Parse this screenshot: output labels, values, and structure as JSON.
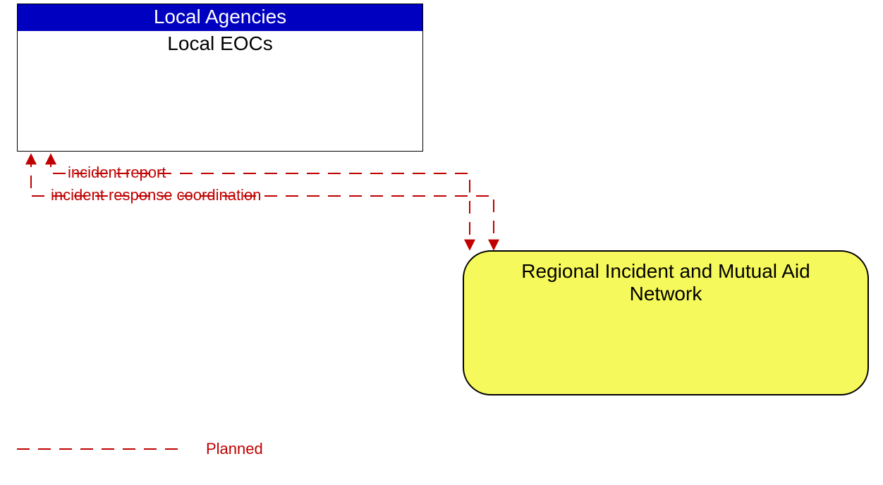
{
  "nodes": {
    "localAgencies": {
      "header": "Local Agencies",
      "body": "Local EOCs"
    },
    "regionNode": {
      "line1": "Regional Incident and Mutual Aid",
      "line2": "Network"
    }
  },
  "flows": {
    "incidentReport": "incident report",
    "incidentResponseCoordination": "incident response coordination"
  },
  "legend": {
    "planned": "Planned"
  },
  "colors": {
    "plannedLine": "#c00000",
    "headerBg": "#0000c0",
    "regionFill": "#f6f95b"
  }
}
